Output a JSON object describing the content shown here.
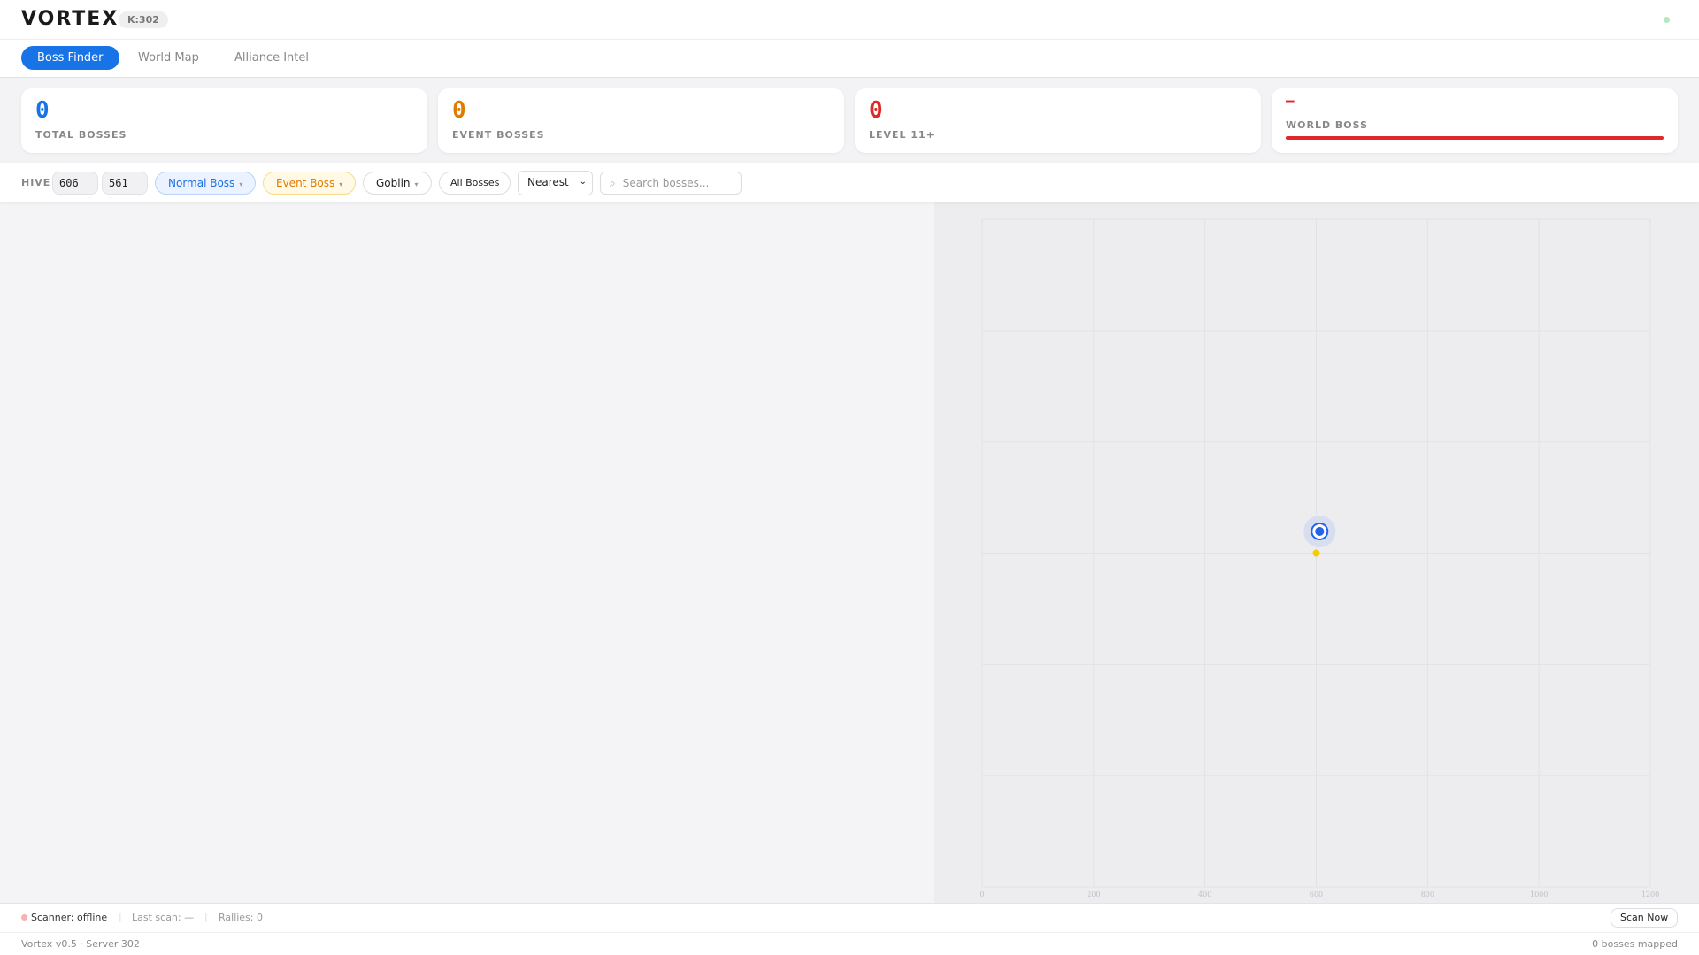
{
  "header": {
    "logo": "VORTEX",
    "kingdom_badge": "K:302"
  },
  "tabs": [
    {
      "label": "Boss Finder",
      "active": true
    },
    {
      "label": "World Map"
    },
    {
      "label": "Alliance Intel"
    }
  ],
  "stats": [
    {
      "value": "0",
      "label": "TOTAL BOSSES",
      "color": "#1773e6"
    },
    {
      "value": "0",
      "label": "EVENT BOSSES",
      "color": "#e07b00"
    },
    {
      "value": "0",
      "label": "LEVEL 11+",
      "color": "#e02828"
    },
    {
      "value": "–",
      "label": "WORLD BOSS",
      "color": "#e02828",
      "progress": 1.0
    }
  ],
  "filters": {
    "hive_label": "HIVE",
    "hive_x": "606",
    "hive_y": "561",
    "normal_boss": "Normal Boss",
    "event_boss": "Event Boss",
    "goblin": "Goblin",
    "all_bosses": "All Bosses",
    "sort": "Nearest",
    "search_placeholder": "Search bosses..."
  },
  "map": {
    "x_ticks": [
      "0",
      "200",
      "400",
      "600",
      "800",
      "1000",
      "1200"
    ],
    "range": [
      0,
      1200
    ],
    "hive": {
      "x": 606,
      "y": 561
    },
    "center": {
      "x": 600,
      "y": 600
    }
  },
  "statusbar": {
    "scanner": "Scanner: offline",
    "last_scan": "Last scan: —",
    "rallies": "Rallies: 0",
    "scan_button": "Scan Now"
  },
  "footer": {
    "version": "Vortex v0.5 · Server 302",
    "mapped": "0 bosses mapped"
  }
}
